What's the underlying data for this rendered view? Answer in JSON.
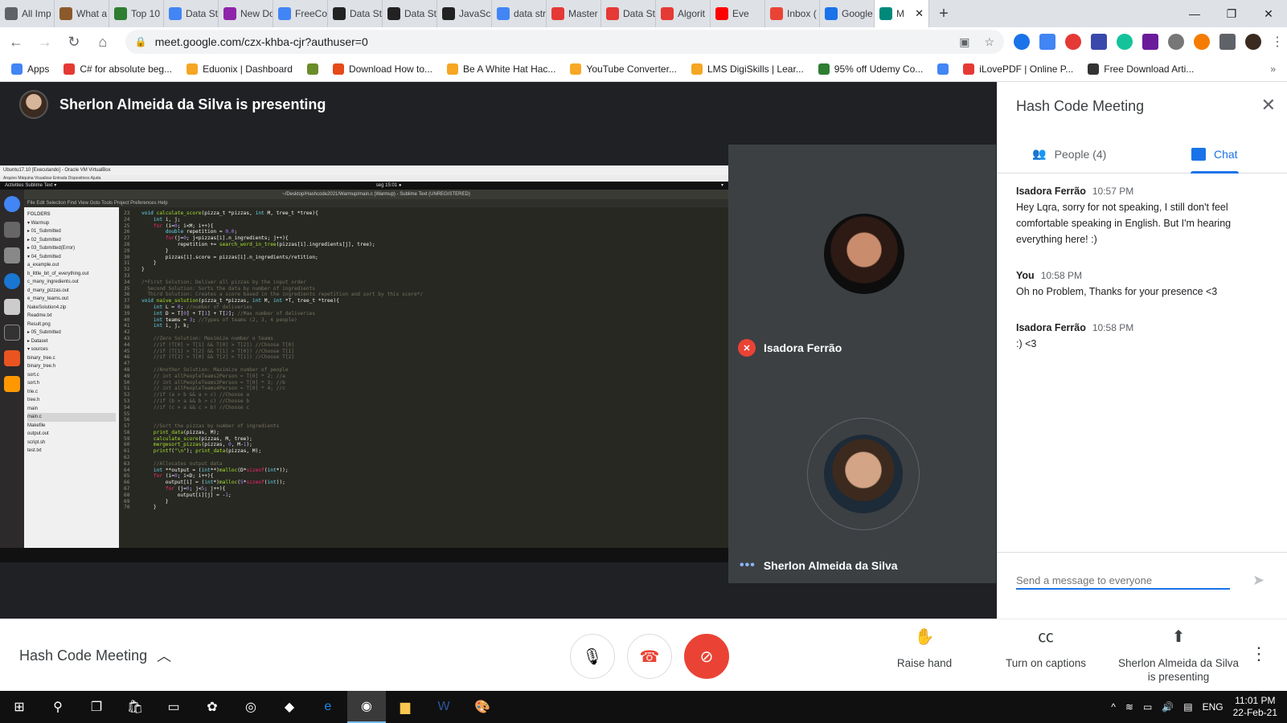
{
  "browser": {
    "tabs": [
      {
        "label": "All Imp",
        "color": "#5f6368"
      },
      {
        "label": "What a",
        "color": "#8b5a2b"
      },
      {
        "label": "Top 10",
        "color": "#2e7d32"
      },
      {
        "label": "Data St",
        "color": "#4285f4"
      },
      {
        "label": "New Do",
        "color": "#8e24aa"
      },
      {
        "label": "FreeCo",
        "color": "#4285f4"
      },
      {
        "label": "Data St",
        "color": "#222222"
      },
      {
        "label": "Data St",
        "color": "#222222"
      },
      {
        "label": "JavaScr",
        "color": "#222222"
      },
      {
        "label": "data str",
        "color": "#4285f4"
      },
      {
        "label": "Master",
        "color": "#e53935"
      },
      {
        "label": "Data St",
        "color": "#e53935"
      },
      {
        "label": "Algorit",
        "color": "#e53935"
      },
      {
        "label": "Eve",
        "color": "#ff0000"
      },
      {
        "label": "Inbox (",
        "color": "#ea4335"
      },
      {
        "label": "Google",
        "color": "#1a73e8"
      }
    ],
    "active_tab_label": "M",
    "url": "meet.google.com/czx-khba-cjr?authuser=0",
    "bookmarks": [
      {
        "label": "Apps",
        "color": "#4285f4"
      },
      {
        "label": "C# for absolute beg...",
        "color": "#e53935"
      },
      {
        "label": "Eduonix | Dashboard",
        "color": "#f5a623"
      },
      {
        "label": "",
        "color": "#6a8c2a"
      },
      {
        "label": "Download How to...",
        "color": "#e64a19"
      },
      {
        "label": "Be A White Hat Hac...",
        "color": "#f5a623"
      },
      {
        "label": "YouTube Converter...",
        "color": "#f9a825"
      },
      {
        "label": "LMS DigiSkills | Lear...",
        "color": "#f5a623"
      },
      {
        "label": "95% off Udemy Co...",
        "color": "#2e7d32"
      },
      {
        "label": "",
        "color": "#4285f4"
      },
      {
        "label": "iLovePDF | Online P...",
        "color": "#e53935"
      },
      {
        "label": "Free Download Arti...",
        "color": "#333333"
      }
    ]
  },
  "meet": {
    "presenting_banner": "Sherlon Almeida da Silva is presenting",
    "participant1": "Isadora Ferrão",
    "participant2": "Sherlon Almeida da Silva",
    "shared_screen": {
      "vm_title": "Ubuntu17.10 [Executando] - Oracle VM VirtualBox",
      "vm_menu": "Arquivo   Máquina   Visualizar   Entrada   Dispositivos   Ajuda",
      "ubuntu_activities": "Activities   Sublime Text ▾",
      "ubuntu_clock": "seg 15:01 ●",
      "editor_title": "~/Desktop/Hashcode2021/Warmup/main.c (Warmup) - Sublime Text (UNREGISTERED)",
      "editor_menu": "File  Edit  Selection  Find  View  Goto  Tools  Project  Preferences  Help",
      "folders_header": "FOLDERS",
      "files": [
        "▾ Warmup",
        "  ▸ 01_Submitted",
        "  ▸ 02_Submitted",
        "  ▸ 03_Submitted(Error)",
        "  ▾ 04_Submitted",
        "     a_example.out",
        "     b_little_bit_of_everything.out",
        "     c_many_ingredients.out",
        "     d_many_pizzas.out",
        "     e_many_teams.out",
        "     NakeSolution4.zip",
        "     Readme.txt",
        "     Result.png",
        "  ▸ 05_Submitted",
        "  ▸ Dataset",
        "  ▾ sources",
        "     binary_tree.c",
        "     binary_tree.h",
        "     sort.c",
        "     sort.h",
        "     trie.c",
        "     tree.h",
        "  main",
        "  main.c",
        "  Makefile",
        "  output.out",
        "  script.sh",
        "  test.txt"
      ]
    }
  },
  "chat": {
    "title": "Hash Code Meeting",
    "people_tab": "People (4)",
    "chat_tab": "Chat",
    "messages": [
      {
        "sender": "Isadora Ferrão",
        "time": "10:57 PM",
        "text": "Hey Lqra, sorry for not speaking, I still don't feel comfortable speaking in English. But I'm hearing everything here! :)"
      },
      {
        "sender": "You",
        "time": "10:58 PM",
        "text": "Oh no Problem, Thanks for your presence <3"
      },
      {
        "sender": "Isadora Ferrão",
        "time": "10:58 PM",
        "text": ":) <3"
      }
    ],
    "input_placeholder": "Send a message to everyone"
  },
  "controls": {
    "meeting_name": "Hash Code Meeting",
    "raise_hand": "Raise hand",
    "captions": "Turn on captions",
    "presenting": "Sherlon Almeida da Silva is presenting"
  },
  "taskbar": {
    "language": "ENG",
    "time": "11:01 PM",
    "date": "22-Feb-21"
  }
}
